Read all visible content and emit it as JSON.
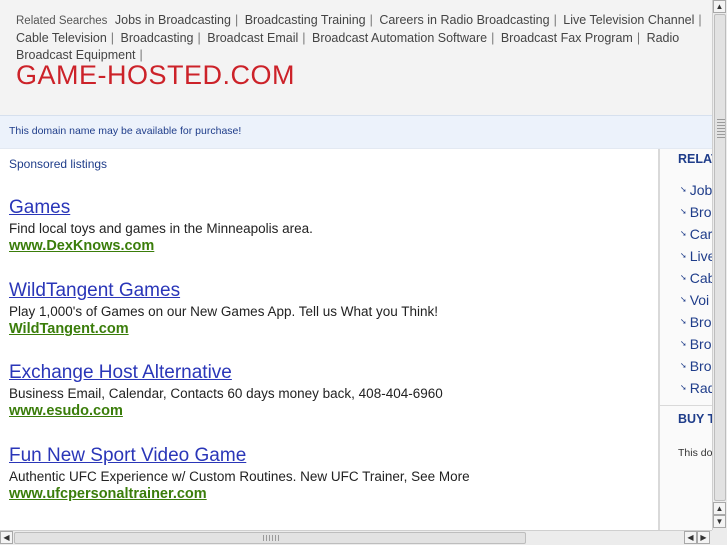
{
  "related_bar": {
    "label": "Related Searches",
    "links": [
      "Jobs in Broadcasting",
      "Broadcasting Training",
      "Careers in Radio Broadcasting",
      "Live Television Channel",
      "Cable Television",
      "Broadcasting",
      "Broadcast Email",
      "Broadcast Automation Software",
      "Broadcast Fax Program",
      "Radio Broadcast Equipment"
    ],
    "separator": "|"
  },
  "site": {
    "title": "GAME-HOSTED.COM"
  },
  "availability": {
    "text": "This domain name may be available for purchase!"
  },
  "main": {
    "sponsored_label": "Sponsored listings",
    "ads": [
      {
        "title": "Games",
        "desc": "Find local toys and games in the Minneapolis area.",
        "url": "www.DexKnows.com"
      },
      {
        "title": "WildTangent Games",
        "desc": "Play 1,000's of Games on our New Games App. Tell us What you Think!",
        "url": "WildTangent.com"
      },
      {
        "title": "Exchange Host Alternative",
        "desc": "Business Email, Calendar, Contacts 60 days money back, 408-404-6960",
        "url": "www.esudo.com"
      },
      {
        "title": "Fun New Sport Video Game",
        "desc": "Authentic UFC Experience w/ Custom Routines. New UFC Trainer, See More",
        "url": "www.ufcpersonaltrainer.com"
      }
    ]
  },
  "sidebar": {
    "related_heading": "RELATED SEARCHES",
    "items": [
      "Jobs",
      "Broa",
      "Care",
      "Live",
      "Cab",
      "Voi",
      "Bro",
      "Bro",
      "Bro",
      "Rad"
    ],
    "buy_heading": "BUY THIS DOMAIN",
    "buy_text": "This domain"
  },
  "icons": {
    "scroll_up": "arrow-up-icon",
    "scroll_down": "arrow-down-icon",
    "scroll_left": "arrow-left-icon",
    "scroll_right": "arrow-right-icon"
  },
  "colors": {
    "title_red": "#cc2229",
    "link_blue": "#2a36b8",
    "url_green": "#3a7d0a",
    "header_bg": "#f3f3f3",
    "avail_bg": "#ecf2fb"
  }
}
